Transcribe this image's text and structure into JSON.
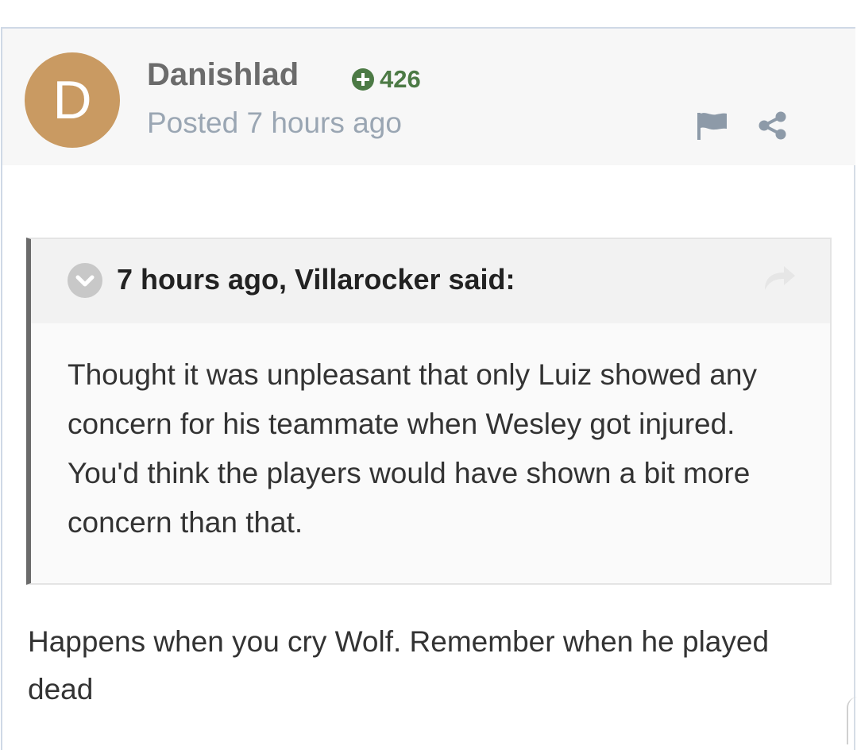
{
  "post": {
    "avatar_letter": "D",
    "author_name": "Danishlad",
    "reputation": "426",
    "posted_time": "Posted 7 hours ago",
    "quote": {
      "citation": "7 hours ago, Villarocker said:",
      "body": "Thought it was unpleasant that only Luiz showed any concern for his teammate when Wesley got injured. You'd think the players would have shown a bit more concern than that."
    },
    "reply_text": "Happens when you cry Wolf. Remember when he played dead"
  },
  "icons": {
    "reputation": "plus-circle-icon",
    "report": "flag-icon",
    "share": "share-icon",
    "quote_toggle": "chevron-down-icon",
    "quote_goto": "share-arrow-icon"
  },
  "colors": {
    "avatar": "#c99a62",
    "reputation": "#4c7a45",
    "header_bg": "#f7f7f7",
    "quote_border": "#6b6b6b"
  }
}
